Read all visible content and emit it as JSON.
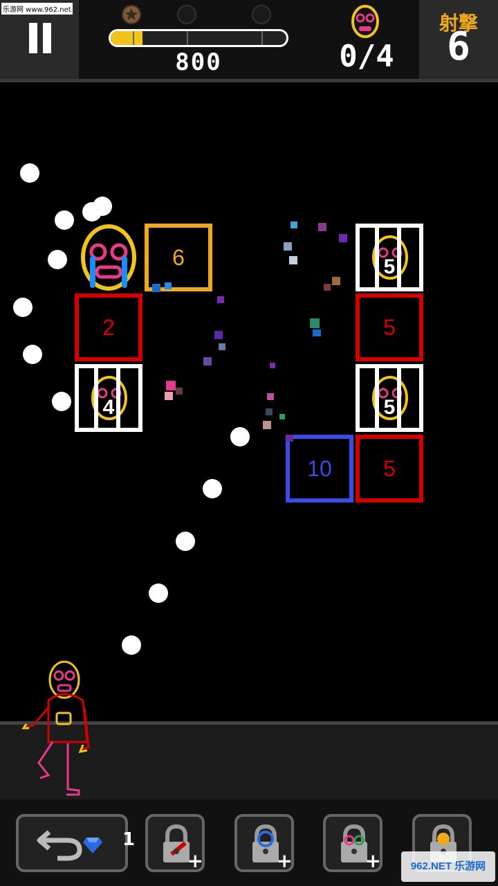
{
  "watermark": "乐游网 www.962.net",
  "header": {
    "stars_earned": 1,
    "stars_total": 3,
    "progress": 0.18,
    "score": "800",
    "rescued": "0/4",
    "shots_label": "射撃",
    "shots_value": "6"
  },
  "blocks": [
    {
      "type": "cage",
      "value": "5"
    },
    {
      "type": "cage",
      "value": "4"
    },
    {
      "type": "cage",
      "value": "5"
    },
    {
      "type": "block",
      "value": "6",
      "color": "#f0a91a"
    },
    {
      "type": "block",
      "value": "2",
      "color": "#d40000"
    },
    {
      "type": "block",
      "value": "5",
      "color": "#d40000"
    },
    {
      "type": "block",
      "value": "10",
      "color": "#3c4be8"
    },
    {
      "type": "block",
      "value": "5",
      "color": "#d40000"
    }
  ],
  "colors": {
    "accent": "#f0a91a",
    "neon_pink": "#e83a8a",
    "neon_yellow": "#f0c419"
  },
  "icons": {
    "pause": "pause-icon",
    "undo": "undo-arrow-icon",
    "gem": "diamond-icon",
    "lock": "padlock-icon"
  },
  "bottom": {
    "gem_count": "1",
    "slots": [
      "rocket",
      "bomb",
      "multi-ball",
      "shield"
    ]
  },
  "brand_watermark": "962.NET 乐游网"
}
